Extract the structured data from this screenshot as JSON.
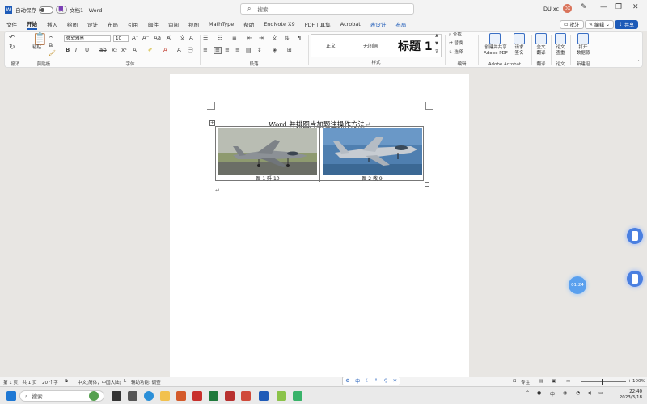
{
  "titlebar": {
    "autosave_label": "自动保存",
    "autosave_state": "关",
    "doc_title": "文档1 - Word",
    "search_placeholder": "搜索",
    "user_name": "DU xc",
    "avatar_initials": "DX"
  },
  "menu": {
    "tabs": [
      "文件",
      "开始",
      "插入",
      "绘图",
      "设计",
      "布局",
      "引用",
      "邮件",
      "审阅",
      "视图",
      "MathType",
      "帮助",
      "EndNote X9",
      "PDF工具集",
      "Acrobat",
      "表设计",
      "布局"
    ],
    "active_index": 1,
    "comment_label": "批注",
    "edit_label": "编辑",
    "share_label": "共享"
  },
  "ribbon": {
    "paste_label": "粘贴",
    "font_name": "微软雅黑",
    "font_size": "10",
    "styles": {
      "normal": "正文",
      "no_spacing": "无间隔",
      "heading1": "标题 1"
    },
    "find_label": "查找",
    "replace_label": "替换",
    "select_label": "选择",
    "acrobat_create": "创建并共享\nAdobe PDF",
    "acrobat_sign": "请求\n签名",
    "translate_label": "全文\n翻译",
    "paper_label": "论文\n查重",
    "open_label": "打开\n数据源",
    "groups": {
      "undo": "撤消",
      "clipboard": "剪贴板",
      "font": "字体",
      "paragraph": "段落",
      "styles": "样式",
      "editing": "编辑",
      "acrobat": "Adobe Acrobat",
      "translate": "翻译",
      "paper": "论文",
      "new_group": "新建组"
    }
  },
  "document": {
    "title_pre": "Word 并排图片加题",
    "title_underlined": "注操作",
    "title_post": "方法",
    "para_mark": "↵",
    "captions": [
      "图 1 歼 10",
      "图 2 教 9"
    ]
  },
  "widgets": {
    "timer": "01:24"
  },
  "statusbar": {
    "page": "第 1 页，共 1 页",
    "words": "20 个字",
    "language": "中文(简体，中国大陆)",
    "accessibility": "辅助功能: 调查",
    "focus": "专注",
    "zoom": "100%"
  },
  "taskbar": {
    "search_placeholder": "搜索",
    "tray_lang": "中",
    "time": "22:40",
    "date": "2023/3/18"
  },
  "colors": {
    "accent": "#1e5bb8",
    "app_bg": "#e8e6e3",
    "page": "#ffffff"
  }
}
